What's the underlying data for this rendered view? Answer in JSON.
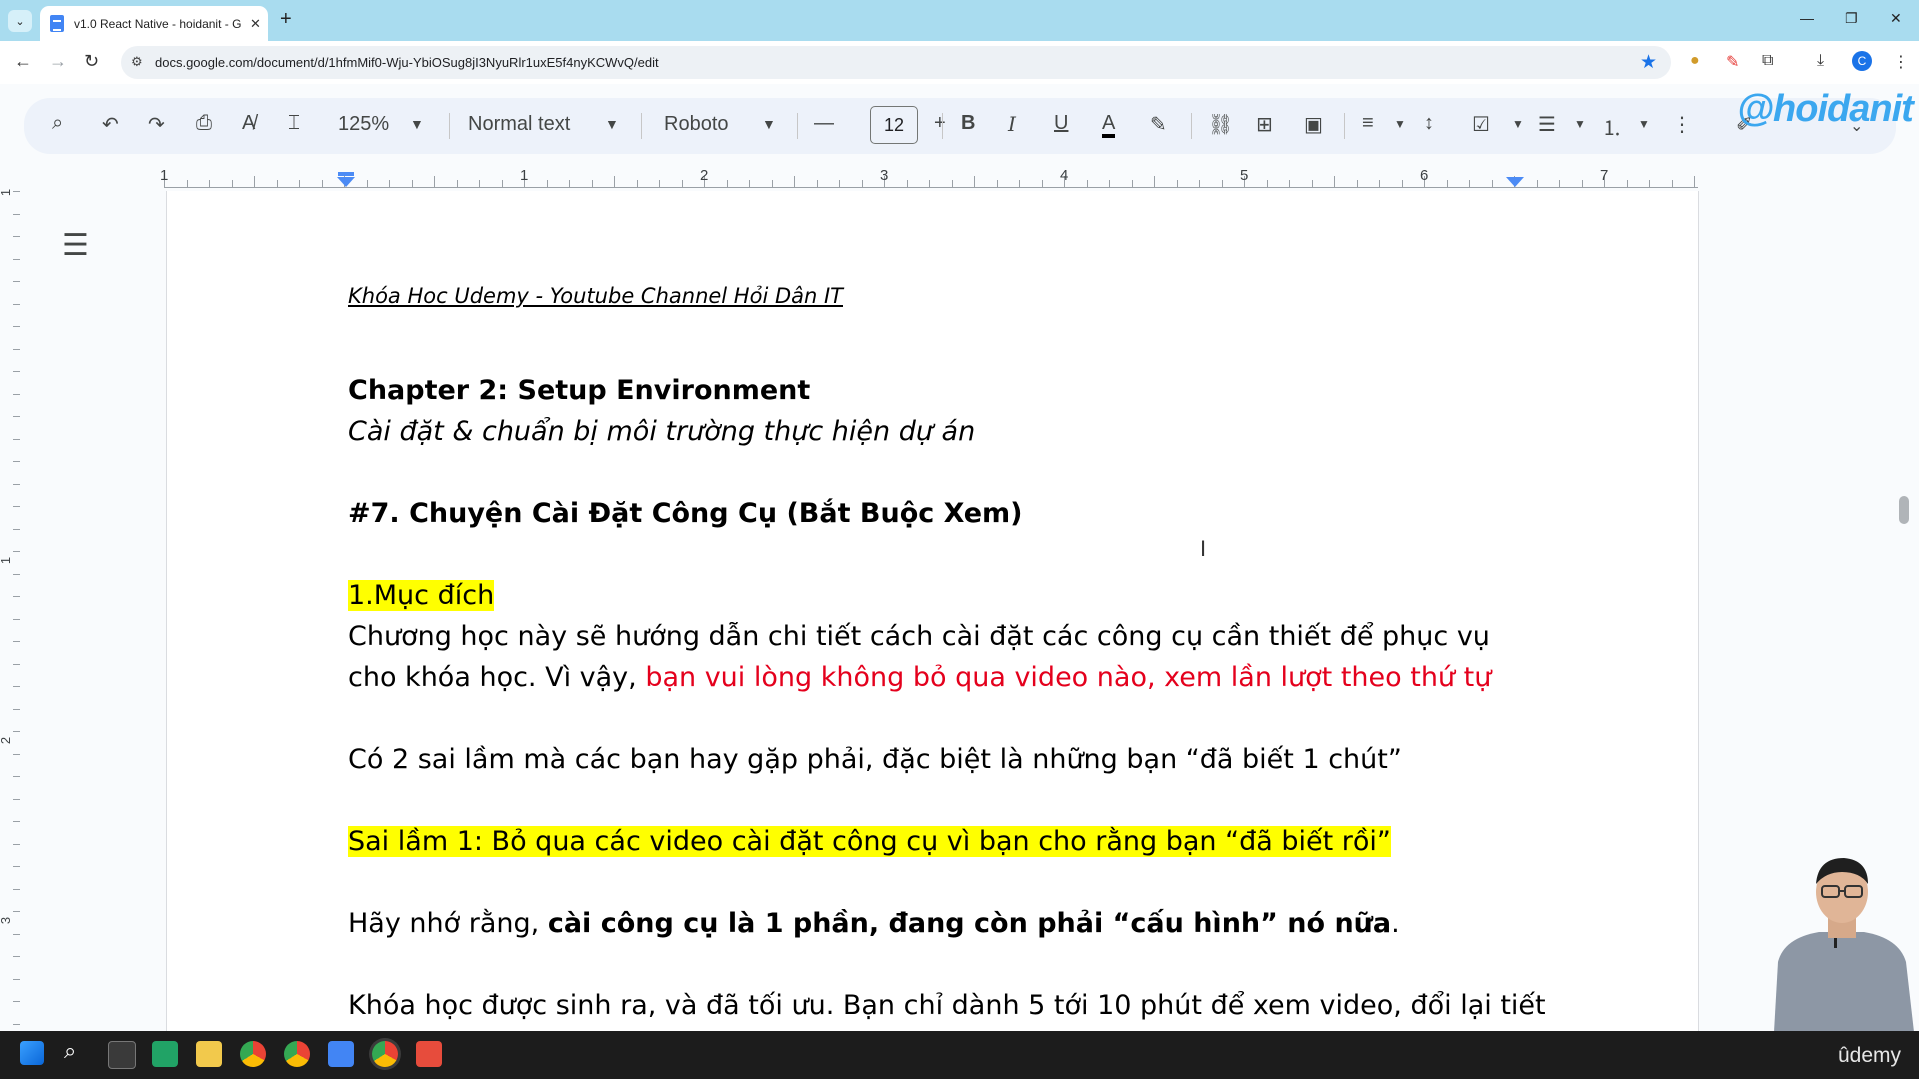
{
  "browser": {
    "tab_title": "v1.0 React Native - hoidanit - G",
    "url": "docs.google.com/document/d/1hfmMif0-Wju-YbiOSug8jI3NyuRlr1uxE5f4nyKCWvQ/edit",
    "profile_initial": "C"
  },
  "toolbar": {
    "zoom": "125%",
    "style": "Normal text",
    "font": "Roboto",
    "font_size": "12"
  },
  "watermark": "@hoidanit",
  "ruler": {
    "numbers": [
      "1",
      "1",
      "2",
      "3",
      "4",
      "5",
      "6",
      "7"
    ],
    "vertical_numbers": [
      "1",
      "1",
      "2",
      "3"
    ]
  },
  "document": {
    "header_line": "Khóa Hoc Udemy  - Youtube Channel Hỏi Dân IT",
    "chapter_title": "Chapter 2: Setup Environment",
    "chapter_subtitle": "Cài đặt & chuẩn bị  môi trường thực hiện dự án",
    "lesson_title": "#7. Chuyện Cài Đặt Công Cụ (Bắt Buộc Xem)",
    "section_heading": "1.Mục đích",
    "para1_line1": "Chương học này sẽ hướng dẫn chi tiết cách cài đặt các công cụ cần thiết để phục vụ",
    "para1_line2_plain": "cho khóa học. Vì vậy, ",
    "para1_line2_red": "bạn vui lòng không bỏ qua video nào, xem lần lượt theo thứ tự",
    "para2": "Có 2 sai lầm mà các bạn hay gặp phải, đặc biệt là những bạn “đã biết 1 chút”",
    "mistake1": "Sai lầm 1: Bỏ qua các video cài đặt công cụ vì bạn cho rằng bạn “đã biết rồi”",
    "para3_plain": "Hãy nhớ rằng, ",
    "para3_bold": "cài công cụ là 1 phần, đang còn phải “cấu hình” nó nữa",
    "para3_end": ".",
    "para4": "Khóa học được sinh ra, và đã tối ưu. Bạn chỉ dành 5 tới 10 phút để xem video, đổi lại tiết"
  },
  "taskbar": {
    "brand": "ûdemy"
  },
  "colors": {
    "highlight": "#ffff00",
    "red_text": "#e4001c",
    "accent": "#1a73e8"
  }
}
